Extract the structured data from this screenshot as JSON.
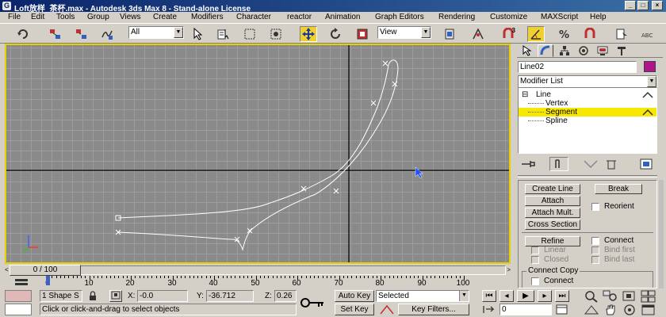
{
  "window": {
    "title": "Loft放样_茶杯.max - Autodesk 3ds Max 8 - Stand-alone License",
    "app_icon_glyph": "G",
    "minimize_glyph": "_",
    "maximize_glyph": "□",
    "close_glyph": "×"
  },
  "menu": [
    "File",
    "Edit",
    "Tools",
    "Group",
    "Views",
    "Create",
    "Modifiers",
    "Character",
    "reactor",
    "Animation",
    "Graph Editors",
    "Rendering",
    "Customize",
    "MAXScript",
    "Help"
  ],
  "toolbar": {
    "selection_filter": "All",
    "reference_coord": "View",
    "icons": [
      "undo-icon",
      "link-icon",
      "unlink-icon",
      "bind-spacewarp-icon",
      "select-icon",
      "select-by-name-icon",
      "rect-region-icon",
      "window-crossing-icon",
      "move-icon",
      "rotate-icon",
      "scale-icon",
      "mirror-icon",
      "align-icon",
      "snap-3d-icon",
      "angle-snap-icon",
      "percent-snap-icon",
      "spinner-snap-icon",
      "named-selection-icon",
      "abc-icon"
    ],
    "snap_label": "3"
  },
  "viewport": {
    "label": "",
    "accent_color": "#e8d000"
  },
  "command_panel": {
    "object_name": "Line02",
    "object_color": "#b0148c",
    "modifier_list": "Modifier List",
    "stack": [
      {
        "label": "Line",
        "indent": 0,
        "prefix": "⊟"
      },
      {
        "label": "Vertex",
        "indent": 1,
        "prefix": ""
      },
      {
        "label": "Segment",
        "indent": 1,
        "prefix": "",
        "selected": true
      },
      {
        "label": "Spline",
        "indent": 1,
        "prefix": ""
      }
    ],
    "buttons": {
      "create_line": "Create Line",
      "break": "Break",
      "attach": "Attach",
      "reorient": "Reorient",
      "attach_mult": "Attach Mult.",
      "cross_section": "Cross Section",
      "refine": "Refine",
      "connect": "Connect",
      "linear": "Linear",
      "bind_first": "Bind first",
      "closed": "Closed",
      "bind_last": "Bind last",
      "connect_copy_group": "Connect Copy",
      "connect_copy": "Connect"
    }
  },
  "time": {
    "slider_label": "0 / 100",
    "left_arrow": "<",
    "right_arrow": ">",
    "ruler": [
      "0",
      "10",
      "20",
      "30",
      "40",
      "50",
      "60",
      "70",
      "80",
      "90",
      "100"
    ]
  },
  "status": {
    "shape_count": "1 Shape S",
    "x_label": "X:",
    "x_value": "-0.0",
    "y_label": "Y:",
    "y_value": "-36.712",
    "z_label": "Z:",
    "z_value": "0.26",
    "prompt": "Click or click-and-drag to select objects",
    "auto_key": "Auto Key",
    "set_key": "Set Key",
    "selected": "Selected",
    "key_filters": "Key Filters...",
    "frame": "0"
  }
}
